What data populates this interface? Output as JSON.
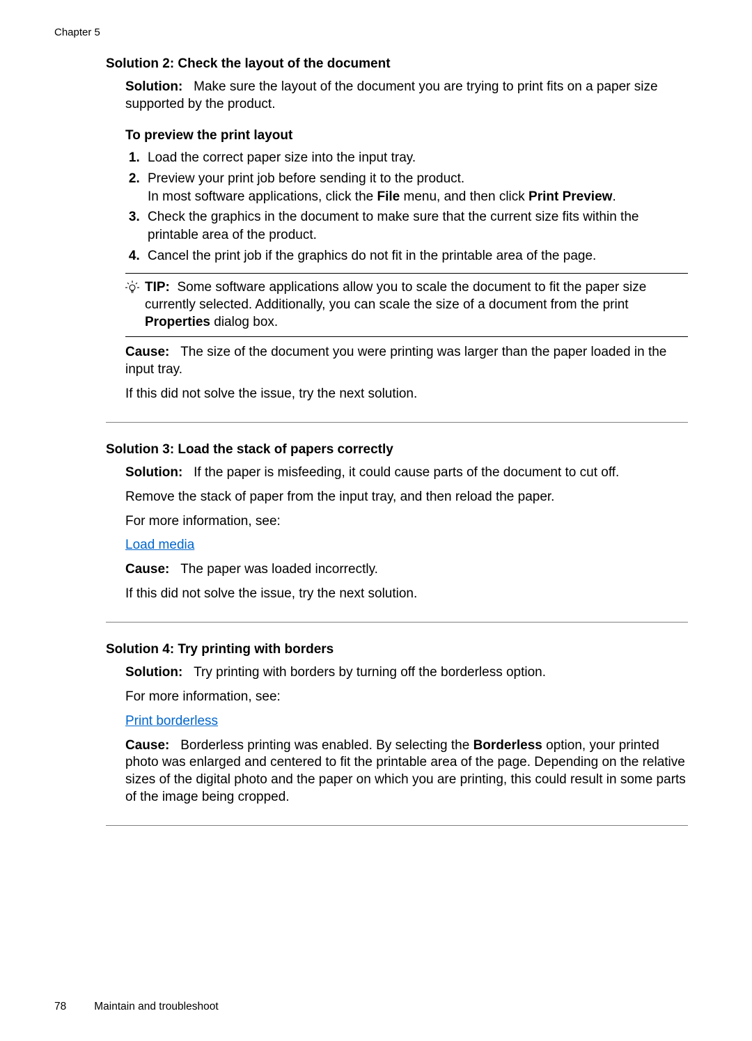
{
  "chapter_header": "Chapter 5",
  "sol2": {
    "heading": "Solution 2: Check the layout of the document",
    "solution_label": "Solution:",
    "solution_text": "Make sure the layout of the document you are trying to print fits on a paper size supported by the product.",
    "preview_heading": "To preview the print layout",
    "step1": "Load the correct paper size into the input tray.",
    "step2_line1": "Preview your print job before sending it to the product.",
    "step2_line2_a": "In most software applications, click the ",
    "step2_file": "File",
    "step2_line2_b": " menu, and then click ",
    "step2_preview": "Print Preview",
    "step2_line2_c": ".",
    "step3": "Check the graphics in the document to make sure that the current size fits within the printable area of the product.",
    "step4": "Cancel the print job if the graphics do not fit in the printable area of the page.",
    "tip_label": "TIP:",
    "tip_text_a": "Some software applications allow you to scale the document to fit the paper size currently selected. Additionally, you can scale the size of a document from the print ",
    "tip_props": "Properties",
    "tip_text_b": " dialog box.",
    "cause_label": "Cause:",
    "cause_text": "The size of the document you were printing was larger than the paper loaded in the input tray.",
    "next": "If this did not solve the issue, try the next solution."
  },
  "sol3": {
    "heading": "Solution 3: Load the stack of papers correctly",
    "solution_label": "Solution:",
    "solution_text": "If the paper is misfeeding, it could cause parts of the document to cut off.",
    "remove": "Remove the stack of paper from the input tray, and then reload the paper.",
    "more_info": "For more information, see:",
    "link": "Load media",
    "cause_label": "Cause:",
    "cause_text": "The paper was loaded incorrectly.",
    "next": "If this did not solve the issue, try the next solution."
  },
  "sol4": {
    "heading": "Solution 4: Try printing with borders",
    "solution_label": "Solution:",
    "solution_text": "Try printing with borders by turning off the borderless option.",
    "more_info": "For more information, see:",
    "link": "Print borderless",
    "cause_label": "Cause:",
    "cause_text_a": "Borderless printing was enabled. By selecting the ",
    "cause_borderless": "Borderless",
    "cause_text_b": " option, your printed photo was enlarged and centered to fit the printable area of the page. Depending on the relative sizes of the digital photo and the paper on which you are printing, this could result in some parts of the image being cropped."
  },
  "footer": {
    "page": "78",
    "title": "Maintain and troubleshoot"
  }
}
